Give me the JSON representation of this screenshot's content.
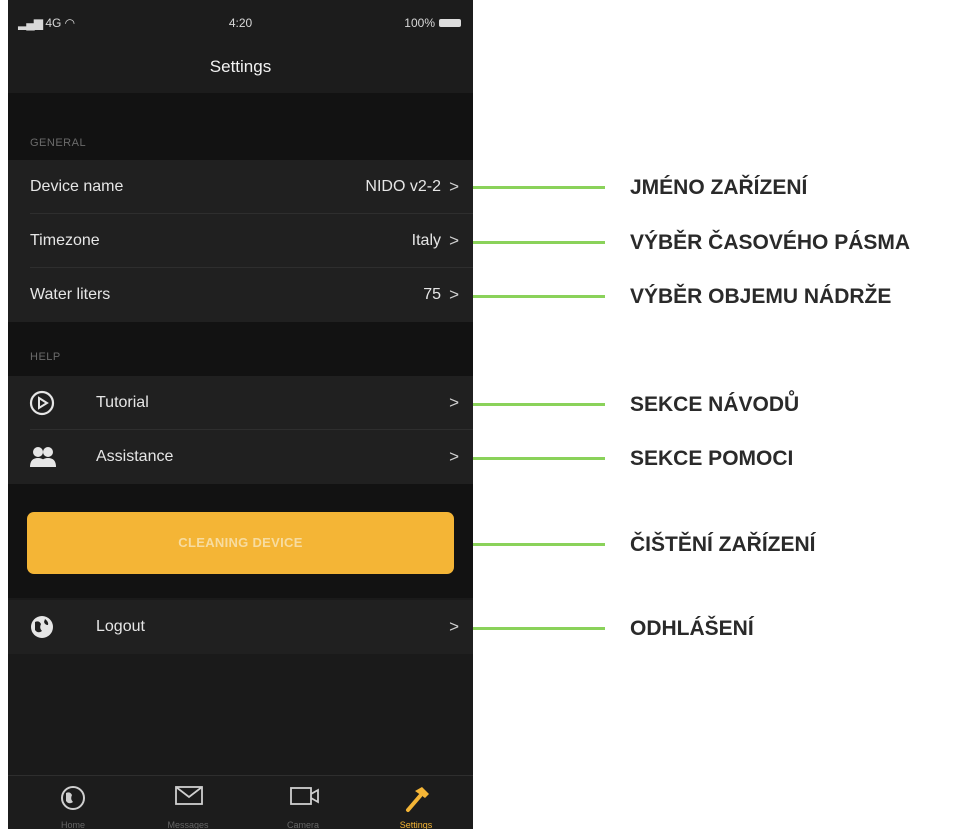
{
  "status_bar": {
    "signal": "4G",
    "time": "4:20",
    "battery": "100%"
  },
  "nav": {
    "title": "Settings"
  },
  "general": {
    "header": "GENERAL",
    "rows": [
      {
        "label": "Device name",
        "value": "NIDO v2-2"
      },
      {
        "label": "Timezone",
        "value": "Italy"
      },
      {
        "label": "Water liters",
        "value": "75"
      }
    ]
  },
  "help": {
    "header": "HELP",
    "rows": [
      {
        "label": "Tutorial",
        "icon": "play-circle-icon"
      },
      {
        "label": "Assistance",
        "icon": "people-icon"
      }
    ]
  },
  "cta": {
    "label": "CLEANING DEVICE"
  },
  "logout": {
    "label": "Logout",
    "icon": "globe-icon"
  },
  "tabs": [
    {
      "label": "Home",
      "icon": "globe-icon"
    },
    {
      "label": "Messages",
      "icon": "envelope-icon"
    },
    {
      "label": "Camera",
      "icon": "video-camera-icon"
    },
    {
      "label": "Settings",
      "icon": "hammer-icon",
      "active": true
    }
  ],
  "annotations": [
    "JMÉNO ZAŘÍZENÍ",
    "VÝBĚR ČASOVÉHO PÁSMA",
    "VÝBĚR OBJEMU NÁDRŽE",
    "SEKCE NÁVODŮ",
    "SEKCE POMOCI",
    "ČIŠTĚNÍ ZAŘÍZENÍ",
    "ODHLÁŠENÍ"
  ],
  "colors": {
    "accent": "#f4b536",
    "callout_line": "#8ad25a",
    "background": "#1a1a1a"
  }
}
